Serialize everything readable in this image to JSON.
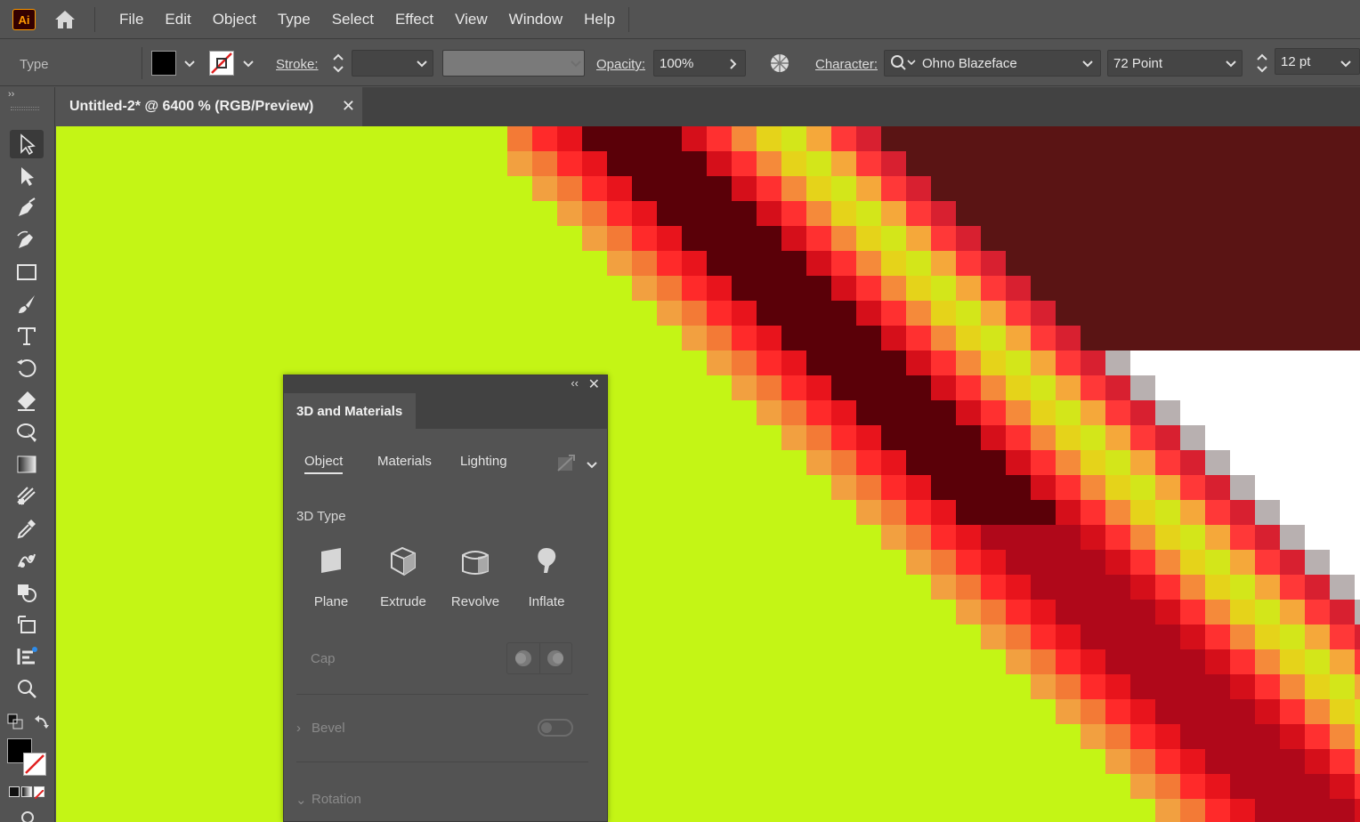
{
  "app": {
    "logo": "Ai"
  },
  "menu": [
    "File",
    "Edit",
    "Object",
    "Type",
    "Select",
    "Effect",
    "View",
    "Window",
    "Help"
  ],
  "control_bar": {
    "mode_label": "Type",
    "stroke_label": "Stroke:",
    "opacity_label": "Opacity:",
    "opacity_value": "100%",
    "character_label": "Character:",
    "font_family": "Ohno Blazeface",
    "font_size": "72 Point",
    "leading": "12 pt"
  },
  "document": {
    "tab_title": "Untitled-2* @ 6400 % (RGB/Preview)",
    "close_glyph": "✕"
  },
  "canvas": {
    "background": "#c4f515"
  },
  "panel": {
    "title": "3D and Materials",
    "collapse_glyph": "‹‹",
    "close_glyph": "✕",
    "subtabs": [
      "Object",
      "Materials",
      "Lighting"
    ],
    "active_subtab": "Object",
    "section_3d_type": "3D Type",
    "types": [
      "Plane",
      "Extrude",
      "Revolve",
      "Inflate"
    ],
    "cap_label": "Cap",
    "bevel_label": "Bevel",
    "rotation_label": "Rotation"
  },
  "toolbar_icons": [
    "selection-tool-icon",
    "direct-selection-tool-icon",
    "pen-tool-icon",
    "curvature-tool-icon",
    "rectangle-tool-icon",
    "paintbrush-tool-icon",
    "type-tool-icon",
    "rotate-tool-icon",
    "eraser-tool-icon",
    "width-tool-icon",
    "gradient-tool-icon",
    "mesh-tool-icon",
    "eyedropper-tool-icon",
    "puppet-warp-tool-icon",
    "shape-builder-tool-icon",
    "artboard-tool-icon",
    "chart-tool-icon",
    "zoom-tool-icon"
  ]
}
